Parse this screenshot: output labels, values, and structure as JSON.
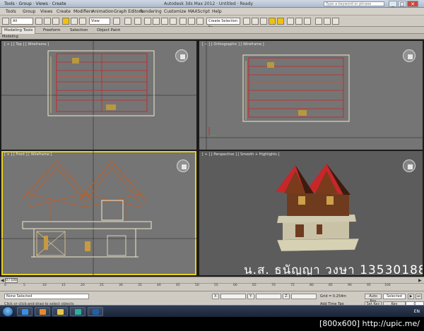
{
  "titlebar": {
    "app_label": "Tools · Group · Views · Create",
    "document": "Autodesk 3ds Max 2012 · Untitled · Ready",
    "search_placeholder": "Type a keyword or phrase",
    "min": "_",
    "max": "□",
    "close": "✕"
  },
  "menu": [
    "Tools",
    "Group",
    "Views",
    "Create",
    "Modifiers",
    "Animation",
    "Graph Editors",
    "Rendering",
    "Customize",
    "MAXScript",
    "Help"
  ],
  "toolbar": {
    "filter_value": "All",
    "view_value": "View",
    "selection_set_placeholder": "Create Selection Se"
  },
  "ribbon": {
    "tabs": [
      "Modeling Tools",
      "Freeform",
      "Selection",
      "Object Paint"
    ],
    "active_index": 0,
    "sub": "Modeling"
  },
  "viewports": {
    "top_left_label": "[ + ] [ Top ] [ Wireframe ]",
    "top_right_label": "[ + ] [ Orthographic ] [ Wireframe ]",
    "bottom_left_label": "[ + ] [ Front ] [ Wireframe ]",
    "bottom_right_label": "[ + ] [ Perspective ] [ Smooth + Highlights ]"
  },
  "watermark": "น.ส. ธนัญญา วงษา 13530188",
  "timeline": {
    "slider": "0 / 100",
    "ticks": [
      "0",
      "5",
      "10",
      "15",
      "20",
      "25",
      "30",
      "35",
      "40",
      "45",
      "50",
      "55",
      "60",
      "65",
      "70",
      "75",
      "80",
      "85",
      "90",
      "95",
      "100"
    ]
  },
  "status": {
    "selection": "None Selected",
    "prompt": "Click or click-and-drag to select objects",
    "x_label": "X:",
    "y_label": "Y:",
    "z_label": "Z:",
    "grid": "Grid = 0.254m",
    "add_tag": "Add Time Tag",
    "auto_key": "Auto Key",
    "set_key": "Set Key",
    "selected": "Selected",
    "key_filters": "Key Filters...",
    "frame": "0"
  },
  "taskbar": {
    "tray": "EN"
  },
  "footer": "[800x600] http://upic.me/",
  "colors": {
    "viewport_bg": "#757575",
    "active_border": "#e8cf22",
    "roof_red": "#c8262b",
    "wall_brown": "#6e3b1f",
    "wire_orange": "#c85a18"
  }
}
